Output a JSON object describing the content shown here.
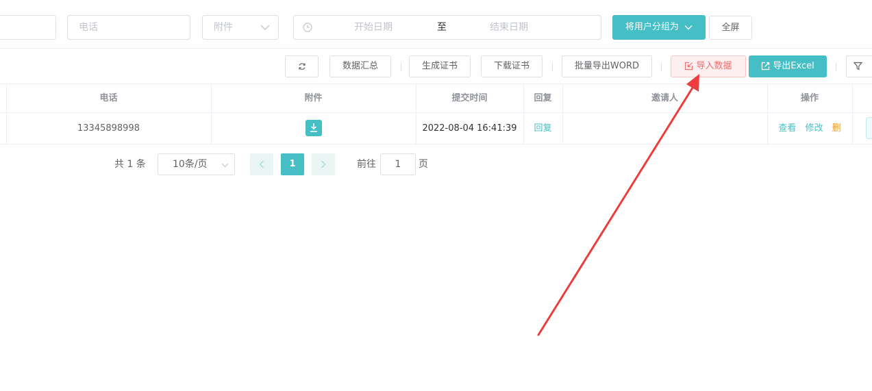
{
  "filters": {
    "phone_placeholder": "电话",
    "attachment_placeholder": "附件",
    "start_date_placeholder": "开始日期",
    "date_separator": "至",
    "end_date_placeholder": "结束日期",
    "group_button": "将用户分组为",
    "fullscreen_button": "全屏"
  },
  "toolbar": {
    "summary": "数据汇总",
    "generate_cert": "生成证书",
    "download_cert": "下载证书",
    "batch_export_word": "批量导出WORD",
    "import_data": "导入数据",
    "export_excel": "导出Excel"
  },
  "table": {
    "headers": {
      "phone": "电话",
      "attachment": "附件",
      "submit_time": "提交时间",
      "reply": "回复",
      "inviter": "邀请人",
      "actions": "操作"
    },
    "rows": [
      {
        "phone": "13345898998",
        "submit_time": "2022-08-04 16:41:39",
        "reply": "回复",
        "inviter": "",
        "view": "查看",
        "edit": "修改",
        "delete": "删"
      }
    ]
  },
  "pagination": {
    "total": "共 1 条",
    "page_size": "10条/页",
    "current_page": "1",
    "goto_label": "前往",
    "goto_value": "1",
    "page_suffix": "页"
  },
  "colors": {
    "accent": "#45bfc5",
    "danger": "#f56c6c",
    "warning": "#e6a23c",
    "annotation_arrow": "#ee3b3b"
  }
}
